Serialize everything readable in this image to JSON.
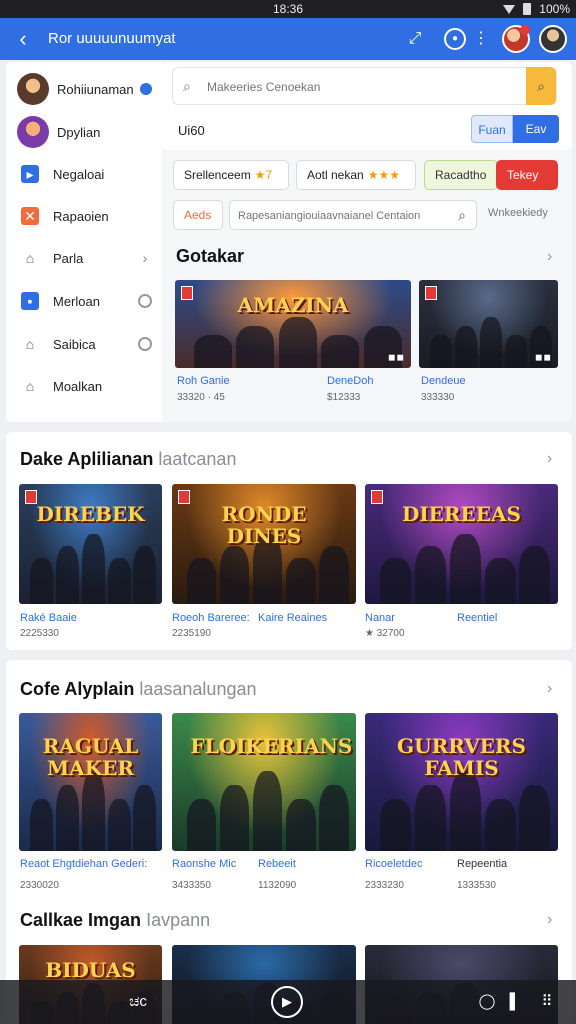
{
  "status_bar": {
    "time": "18:36",
    "battery": "100%"
  },
  "app_bar": {
    "back_icon": "arrow-back-icon",
    "title": "Ror uuuuunuumyat"
  },
  "sidebar": {
    "items": [
      {
        "label": "Rohiiunaman",
        "icon": "user-avatar-icon"
      },
      {
        "label": "Dpylian",
        "icon": "user-avatar-icon"
      },
      {
        "label": "Negaloai",
        "icon": "flag-icon"
      },
      {
        "label": "Rapaoien",
        "icon": "tool-icon"
      },
      {
        "label": "Parla",
        "icon": "home-icon"
      },
      {
        "label": "Merloan",
        "icon": "card-icon"
      },
      {
        "label": "Saibica",
        "icon": "home-outline-icon"
      },
      {
        "label": "Moalkan",
        "icon": "home-alt-icon"
      }
    ]
  },
  "search": {
    "placeholder": "Makeeries Cenoekan",
    "sort_label": "Ui60",
    "toggle_a": "Fuan",
    "toggle_b": "Eav"
  },
  "chips": {
    "c1": "Srellenceem",
    "c1_stars": "★7",
    "c2": "Aotl nekan",
    "c2_stars": "★★★",
    "c3": "Racadtho",
    "c4": "Tekey",
    "c5": "Aeds",
    "filter_placeholder": "Rapesaniangiouiaavnaianel Centaion",
    "filter_right": "Wnkeekiedy"
  },
  "section1": {
    "title": "Gotakar",
    "games": [
      {
        "name": "Roh Ganie",
        "meta": "33320 · 45",
        "thumb_title": "AMAZINA",
        "colors": [
          "#ff9a3c",
          "#2d4a8a",
          "#4a2c2a"
        ]
      },
      {
        "name": "DeneDoh",
        "meta": "$12333",
        "thumb_title": "",
        "colors": [
          "#5a6a8a",
          "#2a3040",
          "#1a1c22"
        ]
      },
      {
        "name": "Dendeue",
        "meta": "333330",
        "thumb_title": "",
        "colors": [
          "#3a4a6a",
          "#1e2530",
          "#141820"
        ]
      }
    ]
  },
  "section2": {
    "title": "Dake Aplilianan",
    "subtitle": "laatcanan",
    "games": [
      {
        "name": "Raké Baaie",
        "meta": "2225330",
        "thumb_title": "DIREBEK",
        "colors": [
          "#3e7bc4",
          "#2a3e5c",
          "#1b2233"
        ]
      },
      {
        "name": "Roeoh Bareree:",
        "meta": "2235190",
        "thumb_title": "RONDE DINES",
        "colors": [
          "#e08a2a",
          "#6a3a14",
          "#2a1a10"
        ]
      },
      {
        "name": "Kaire Reaines",
        "meta": "",
        "thumb_title": "DIEREEAS",
        "colors": [
          "#b04ac0",
          "#4a2a7a",
          "#1e1840"
        ]
      },
      {
        "name": "Nanar",
        "meta": "★ 32700",
        "thumb_title": "",
        "colors": []
      },
      {
        "name": "Reentiel",
        "meta": "",
        "thumb_title": "",
        "colors": []
      }
    ]
  },
  "section3": {
    "title": "Cofe Alyplain",
    "subtitle": "laasanalungan",
    "games": [
      {
        "name": "Reaot Ehgtdiehan Gederi:",
        "meta": "2330020",
        "thumb_title": "RAGUAL MAKER",
        "colors": [
          "#d05a2a",
          "#3a5a9a",
          "#1a2a4a"
        ]
      },
      {
        "name": "Raonshe Mic",
        "meta": "3433350",
        "thumb_title": "FLOIKERIANS",
        "colors": [
          "#e8c23a",
          "#3a8a4a",
          "#1a3a2a"
        ]
      },
      {
        "name": "Rebeeit",
        "meta": "1132090",
        "thumb_title": "",
        "colors": []
      },
      {
        "name": "Ricoeletdec",
        "meta": "2333230",
        "thumb_title": "GURRVERS FAMIS",
        "colors": [
          "#8a3ac0",
          "#3a2a7a",
          "#161a3a"
        ]
      },
      {
        "name": "Repeentia",
        "meta": "1333530",
        "thumb_title": "",
        "colors": []
      }
    ]
  },
  "section4": {
    "title": "Callkae Imgan",
    "subtitle": "Iavpann",
    "games": [
      {
        "thumb_title": "BIDUAS",
        "colors": [
          "#c05a2a",
          "#6a3a20",
          "#2a1a10"
        ]
      },
      {
        "thumb_title": "",
        "colors": [
          "#2a6aa8",
          "#1a2e4a",
          "#10141c"
        ]
      },
      {
        "thumb_title": "",
        "colors": [
          "#4a4a6a",
          "#2a2a3a",
          "#16161e"
        ]
      }
    ]
  },
  "bottom_bar": {
    "left": "ಚc",
    "right": "⠿"
  }
}
